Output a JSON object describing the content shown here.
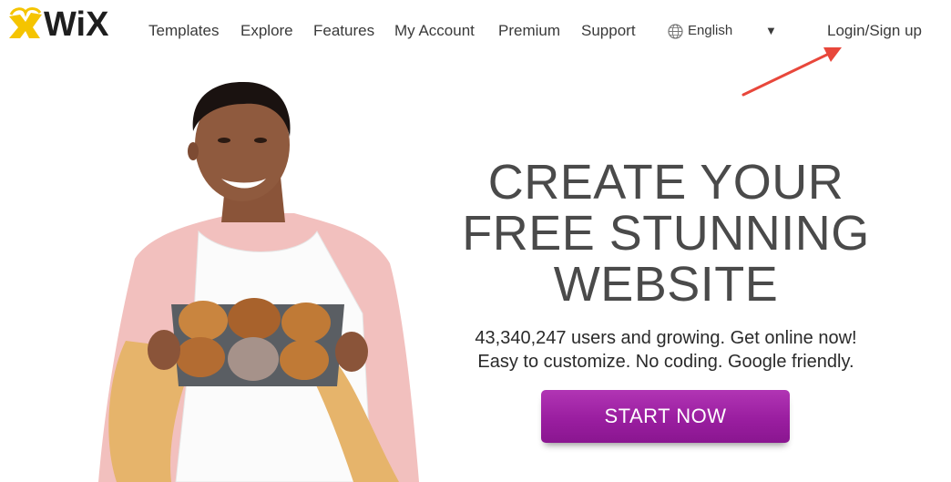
{
  "brand": {
    "logo_text": "WiX",
    "colors": {
      "logo_text": "#1e1e1e",
      "logo_badge": "#f5c400",
      "accent": "#9c22a3",
      "annotation_arrow": "#e8473b"
    }
  },
  "nav": {
    "items": [
      {
        "label": "Templates"
      },
      {
        "label": "Explore"
      },
      {
        "label": "Features"
      },
      {
        "label": "My Account"
      },
      {
        "label": "Premium"
      },
      {
        "label": "Support"
      }
    ],
    "language": {
      "icon": "globe-icon",
      "value": "English",
      "chevron_icon": "chevron-down-icon"
    },
    "login_label": "Login/Sign up"
  },
  "hero": {
    "headline_lines": [
      "CREATE YOUR",
      "FREE STUNNING",
      "WEBSITE"
    ],
    "user_stat": "43,340,247 users and growing. Get online now!",
    "tagline": "Easy to customize. No coding. Google friendly.",
    "cta_label": "START NOW",
    "illustration": "woman holding tray of muffins"
  }
}
